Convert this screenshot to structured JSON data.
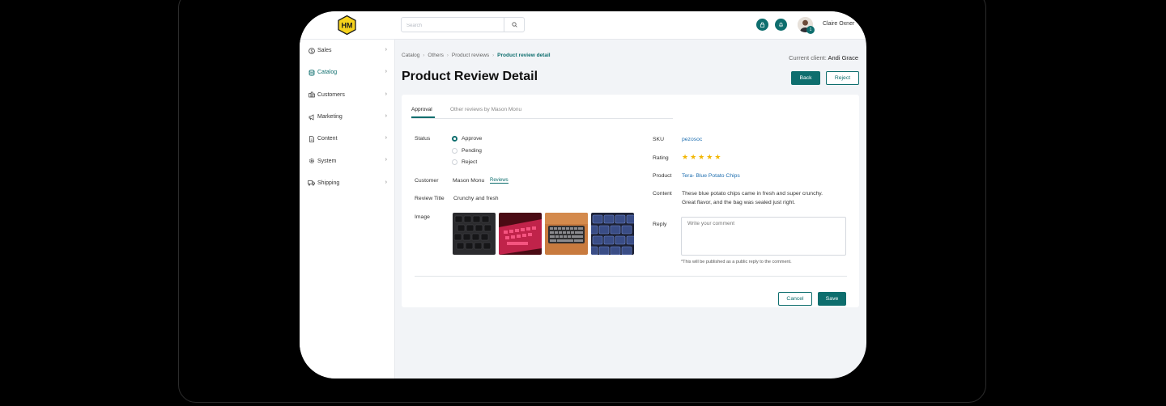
{
  "brand": {
    "logo_text": "HM"
  },
  "search": {
    "placeholder": "Search"
  },
  "user": {
    "name": "Claire Oxner",
    "badge": "1"
  },
  "sidebar": {
    "items": [
      {
        "label": "Sales",
        "icon": "dollar-icon"
      },
      {
        "label": "Catalog",
        "icon": "database-icon"
      },
      {
        "label": "Customers",
        "icon": "users-icon"
      },
      {
        "label": "Marketing",
        "icon": "megaphone-icon"
      },
      {
        "label": "Content",
        "icon": "document-icon"
      },
      {
        "label": "System",
        "icon": "gear-icon"
      },
      {
        "label": "Shipping",
        "icon": "truck-icon"
      }
    ]
  },
  "breadcrumb": {
    "items": [
      "Catalog",
      "Others",
      "Product reviews"
    ],
    "current": "Product review detail"
  },
  "client": {
    "label": "Current client:",
    "name": "Andi Grace"
  },
  "page": {
    "title": "Product Review Detail"
  },
  "actions": {
    "back": "Back",
    "reject": "Reject"
  },
  "tabs": [
    "Approval",
    "Other reviews by Mason Monu"
  ],
  "form": {
    "status_label": "Status",
    "status_options": [
      "Approve",
      "Pending",
      "Reject"
    ],
    "status_selected": "Approve",
    "customer_label": "Customer",
    "customer_name": "Mason Monu",
    "customer_link": "Reviews",
    "review_title_label": "Review Title",
    "review_title": "Crunchy and fresh",
    "image_label": "Image",
    "sku_label": "SKU",
    "sku": "pezosoc",
    "rating_label": "Rating",
    "rating": 5,
    "rating_max": 5,
    "product_label": "Product",
    "product": "Tera- Blue Potato Chips",
    "content_label": "Content",
    "content_line1": "These blue potato chips came in fresh and super crunchy.",
    "content_line2": "Great flavor, and the bag was sealed just right.",
    "reply_label": "Reply",
    "reply_placeholder": "Write your comment",
    "reply_note": "*This will be published as a public reply to the comment."
  },
  "footer": {
    "cancel": "Cancel",
    "save": "Save"
  },
  "colors": {
    "accent": "#0e6e6e",
    "link": "#1f6fb0",
    "star": "#f2b705"
  }
}
